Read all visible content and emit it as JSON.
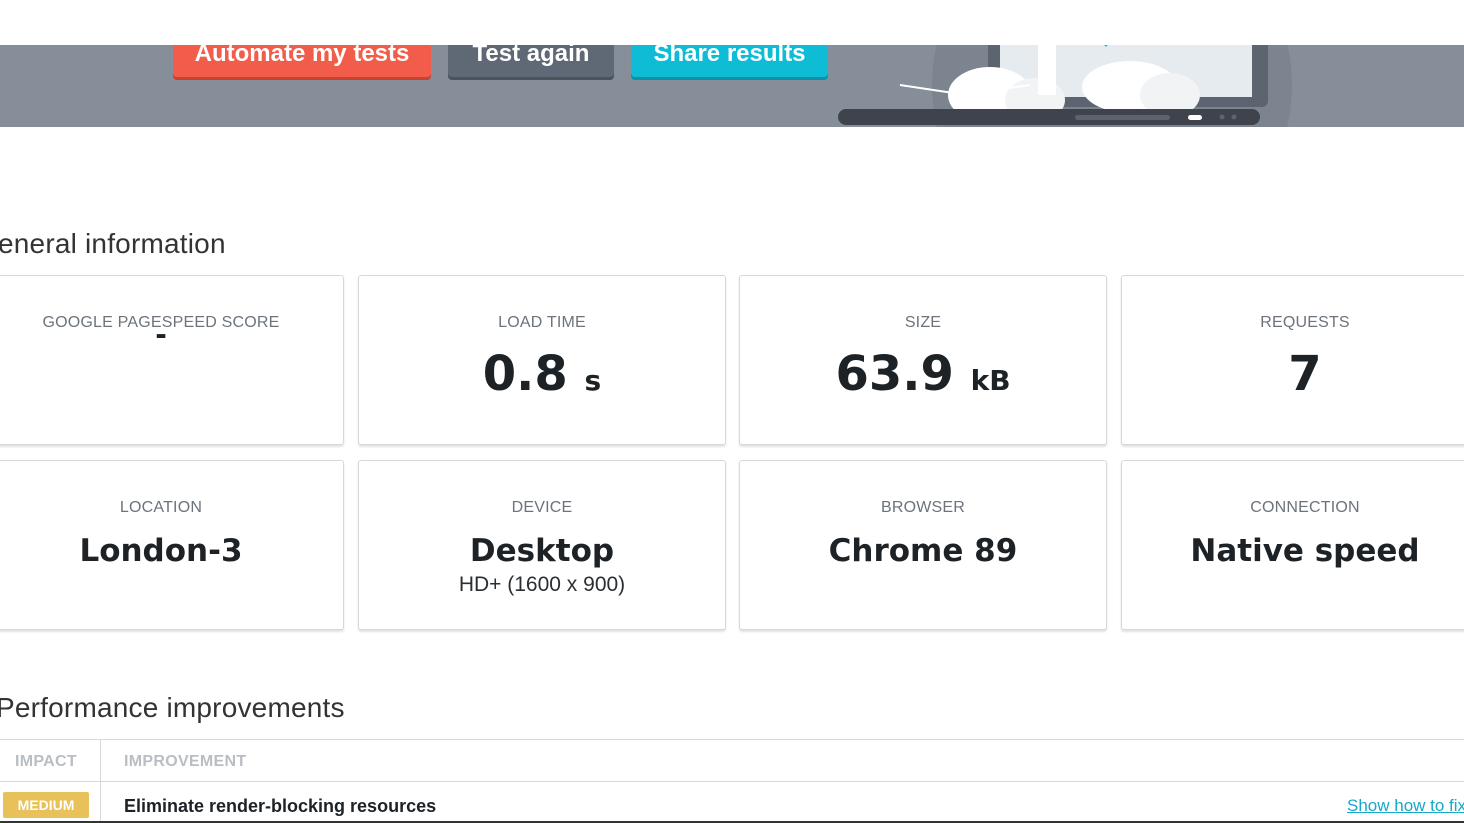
{
  "banner": {
    "buttons": {
      "automate": "Automate my tests",
      "test_again": "Test again",
      "share": "Share results"
    }
  },
  "general": {
    "title": "eneral information",
    "cards": {
      "pagespeed": {
        "label": "GOOGLE PAGESPEED SCORE",
        "value": "-"
      },
      "load_time": {
        "label": "LOAD TIME",
        "value": "0.8",
        "unit": "s"
      },
      "size": {
        "label": "SIZE",
        "value": "63.9",
        "unit": "kB"
      },
      "requests": {
        "label": "REQUESTS",
        "value": "7"
      },
      "location": {
        "label": "LOCATION",
        "value": "London-3"
      },
      "device": {
        "label": "DEVICE",
        "value": "Desktop",
        "sub": "HD+ (1600 x 900)"
      },
      "browser": {
        "label": "BROWSER",
        "value": "Chrome 89"
      },
      "connection": {
        "label": "CONNECTION",
        "value": "Native speed"
      }
    }
  },
  "performance": {
    "title": "Performance improvements",
    "columns": {
      "impact": "IMPACT",
      "improvement": "IMPROVEMENT"
    },
    "rows": [
      {
        "impact": "MEDIUM",
        "improvement": "Eliminate render-blocking resources",
        "action": "Show how to fix"
      }
    ]
  },
  "colors": {
    "banner": "#858e99",
    "automate": "#f25c4a",
    "test_again": "#5f6875",
    "share": "#0fbcd6",
    "medium_badge": "#e8c15a",
    "link": "#18a8c9"
  },
  "icons": {
    "hero": "laptop-illustration-icon"
  }
}
